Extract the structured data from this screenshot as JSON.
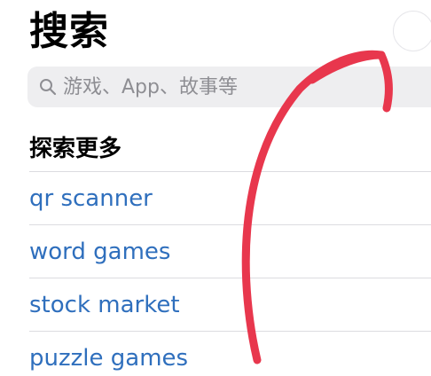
{
  "header": {
    "title": "搜索"
  },
  "search": {
    "placeholder": "游戏、App、故事等",
    "icon": "search-icon"
  },
  "discover": {
    "heading": "探索更多",
    "items": [
      {
        "label": "qr scanner"
      },
      {
        "label": "word games"
      },
      {
        "label": "stock market"
      },
      {
        "label": "puzzle games"
      }
    ]
  },
  "colors": {
    "link": "#2f6fbd",
    "annotation_arrow": "#e8374d",
    "search_bg": "#eeeef0"
  }
}
